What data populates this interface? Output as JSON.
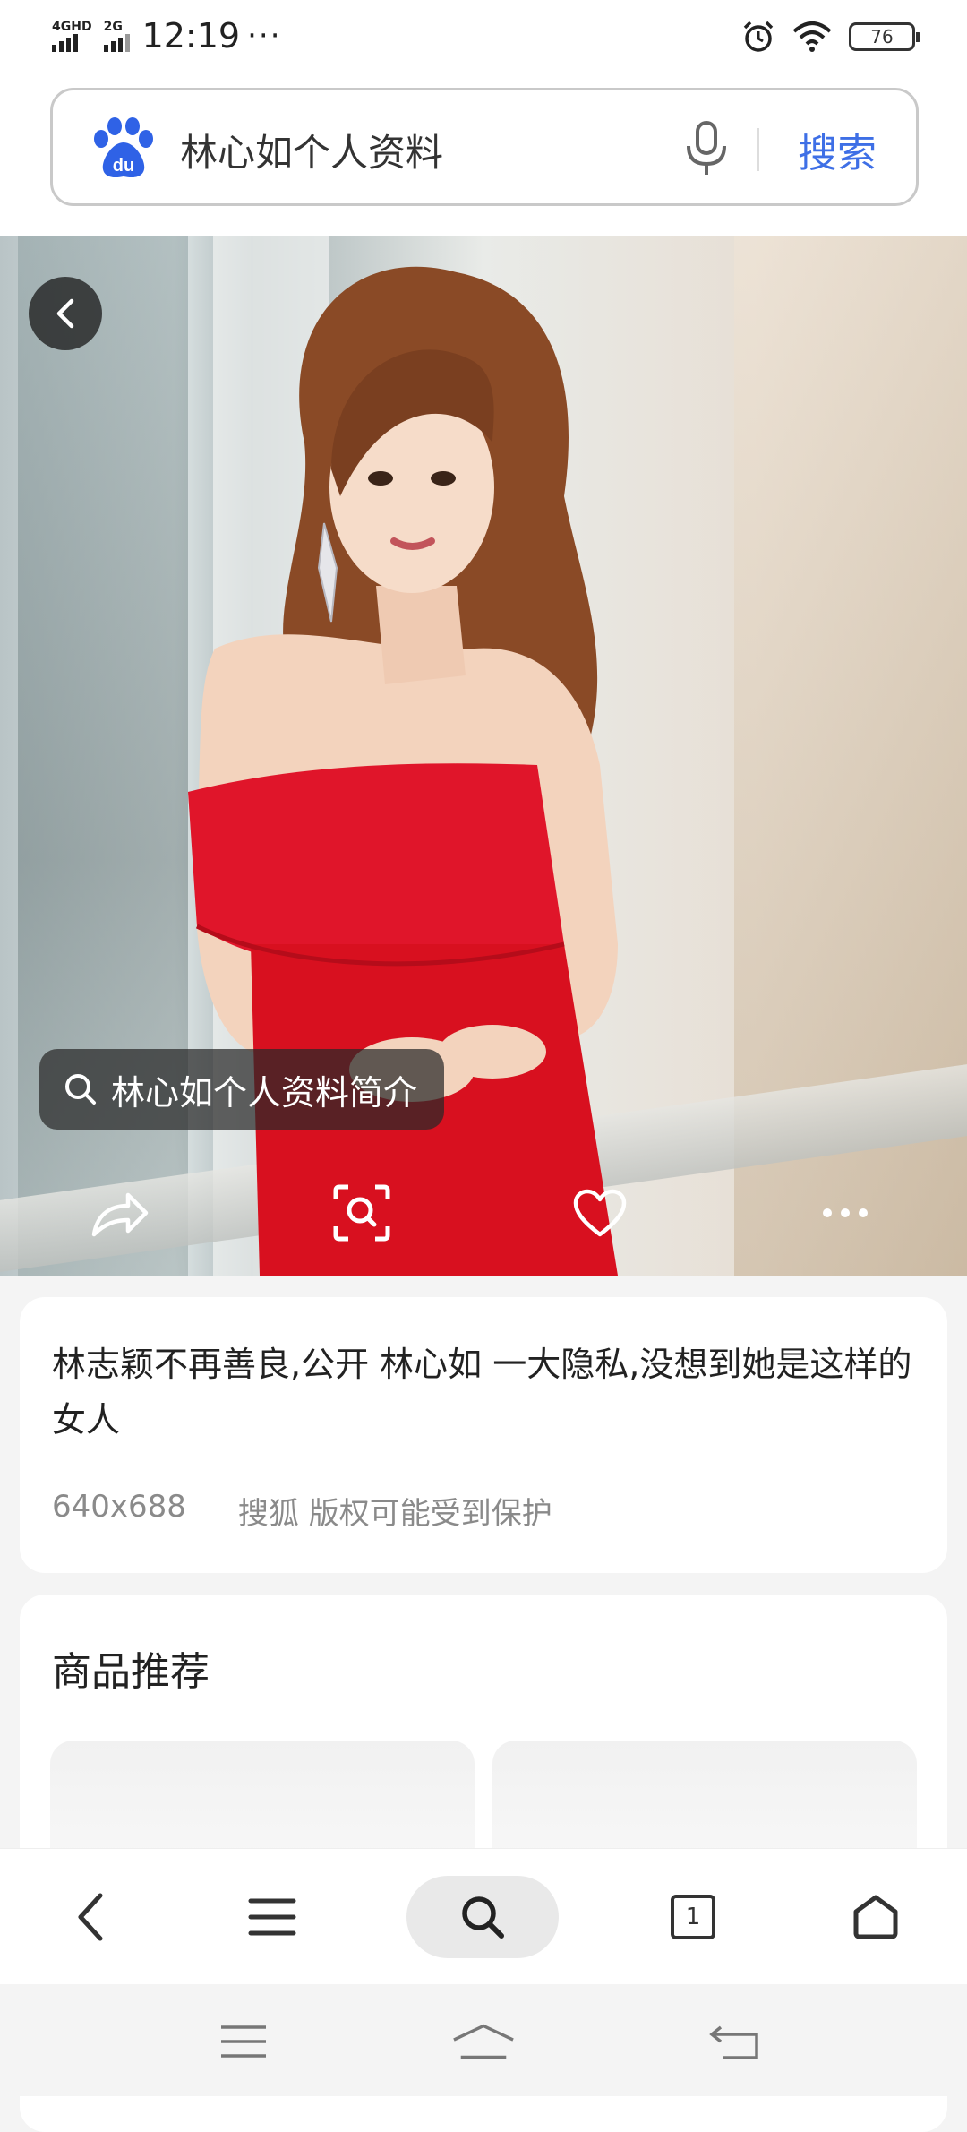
{
  "status_bar": {
    "network_1": "4GHD",
    "network_2": "2G",
    "time": "12:19",
    "more": "···",
    "battery": "76"
  },
  "search": {
    "query": "林心如个人资料",
    "button_label": "搜索",
    "accent_color": "#3e6fe6"
  },
  "image_viewer": {
    "tag_label": "林心如个人资料简介",
    "actions": [
      "share-icon",
      "visual-search-icon",
      "favorite-icon",
      "more-icon"
    ]
  },
  "result_card": {
    "title": "林志颖不再善良,公开 林心如 一大隐私,没想到她是这样的女人",
    "dimensions": "640x688",
    "source": "搜狐 版权可能受到保护"
  },
  "products": {
    "title": "商品推荐"
  },
  "bottom_nav": {
    "tab_count": "1"
  }
}
